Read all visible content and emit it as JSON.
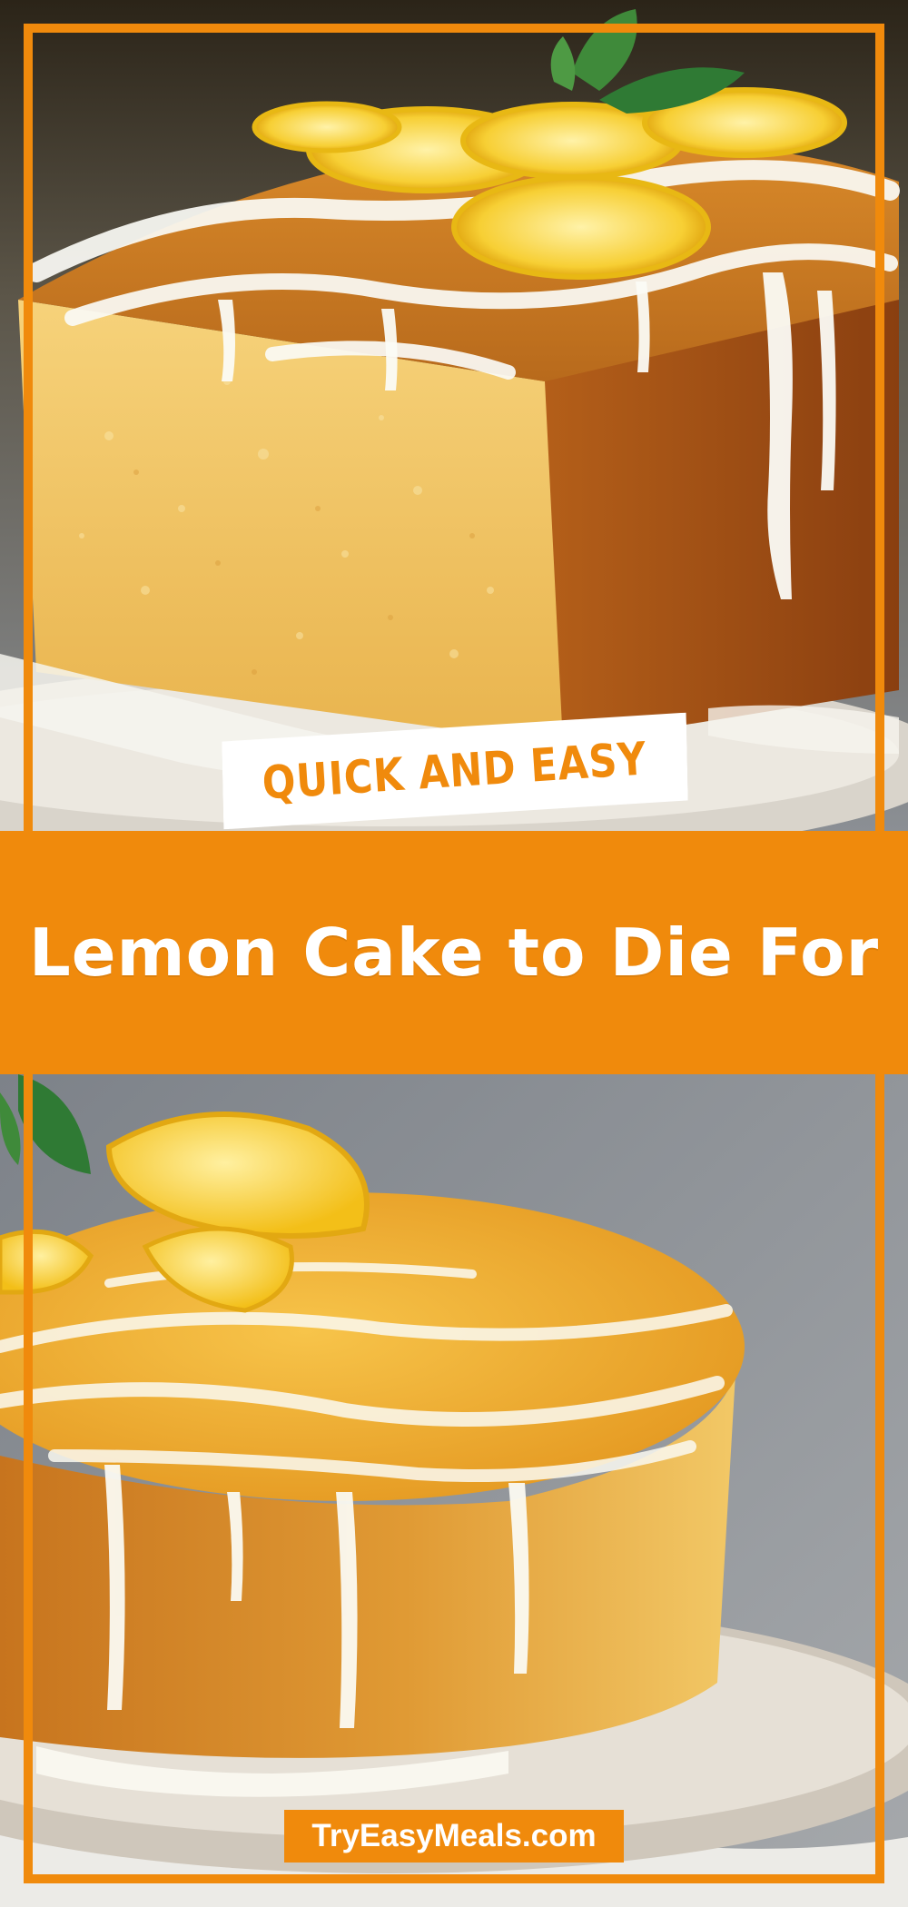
{
  "badge": {
    "text": "QUICK AND EASY"
  },
  "title": "Lemon Cake to Die For",
  "website": "TryEasyMeals.com",
  "colors": {
    "accent": "#f08a0c",
    "text": "#ffffff"
  }
}
